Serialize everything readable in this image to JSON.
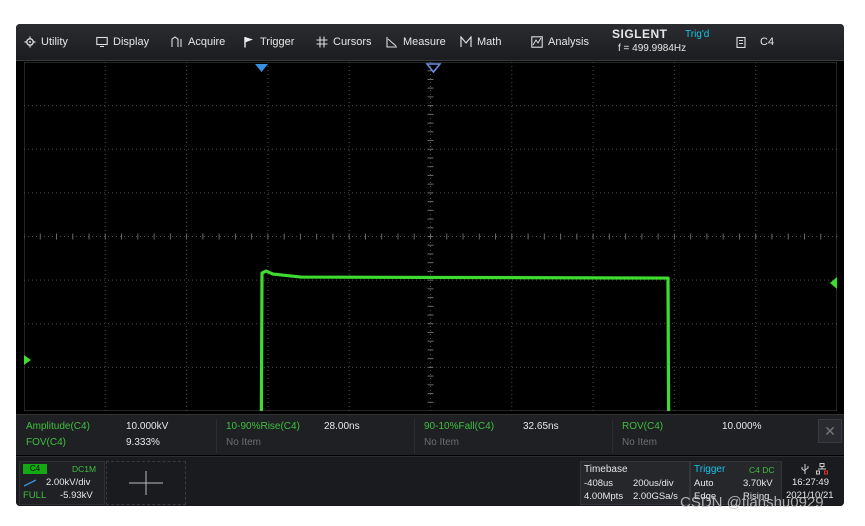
{
  "menu": [
    {
      "label": "Utility",
      "icon": "gear-icon"
    },
    {
      "label": "Display",
      "icon": "monitor-icon"
    },
    {
      "label": "Acquire",
      "icon": "acquire-icon"
    },
    {
      "label": "Trigger",
      "icon": "flag-icon"
    },
    {
      "label": "Cursors",
      "icon": "cursor-grid-icon"
    },
    {
      "label": "Measure",
      "icon": "measure-icon"
    },
    {
      "label": "Math",
      "icon": "math-icon"
    },
    {
      "label": "Analysis",
      "icon": "analysis-icon"
    }
  ],
  "brand": {
    "logo": "SIGLENT",
    "trig_state": "Trig'd",
    "frequency": "f = 499.9984Hz"
  },
  "channel_tag": {
    "label": "C4",
    "icon": "battery-icon"
  },
  "colors": {
    "trace": "#3ddc2f",
    "accent_blue": "#3a8fe0",
    "label_green": "#3fbf3f",
    "trigger_cyan": "#19c2e6"
  },
  "waveform": {
    "channel": "C4",
    "low_level_v": -5.93,
    "high_level_v": 4.07,
    "rise_time_ns": 28.0,
    "fall_time_ns": 32.65
  },
  "measurements": [
    {
      "label": "Amplitude(C4)",
      "value": "10.000kV"
    },
    {
      "label": "10-90%Rise(C4)",
      "value": "28.00ns"
    },
    {
      "label": "90-10%Fall(C4)",
      "value": "32.65ns"
    },
    {
      "label": "ROV(C4)",
      "value": "10.000%"
    },
    {
      "label": "FOV(C4)",
      "value": "9.333%"
    },
    {
      "label": "No Item",
      "value": ""
    },
    {
      "label": "No Item",
      "value": ""
    },
    {
      "label": "No Item",
      "value": ""
    }
  ],
  "channel_box": {
    "name": "C4",
    "coupling": "DC1M",
    "scale": "2.00kV/div",
    "bw": "FULL",
    "offset": "-5.93kV"
  },
  "timebase": {
    "title": "Timebase",
    "delay": "-408us",
    "scale": "200us/div",
    "memory": "4.00Mpts",
    "rate": "2.00GSa/s"
  },
  "trigger": {
    "title": "Trigger",
    "source": "C4 DC",
    "mode": "Auto",
    "level": "3.70kV",
    "type": "Edge",
    "slope": "Rising"
  },
  "clock": {
    "time": "16:27:49",
    "date": "2021/10/21"
  },
  "watermark": "CSDN @tianshu0929"
}
